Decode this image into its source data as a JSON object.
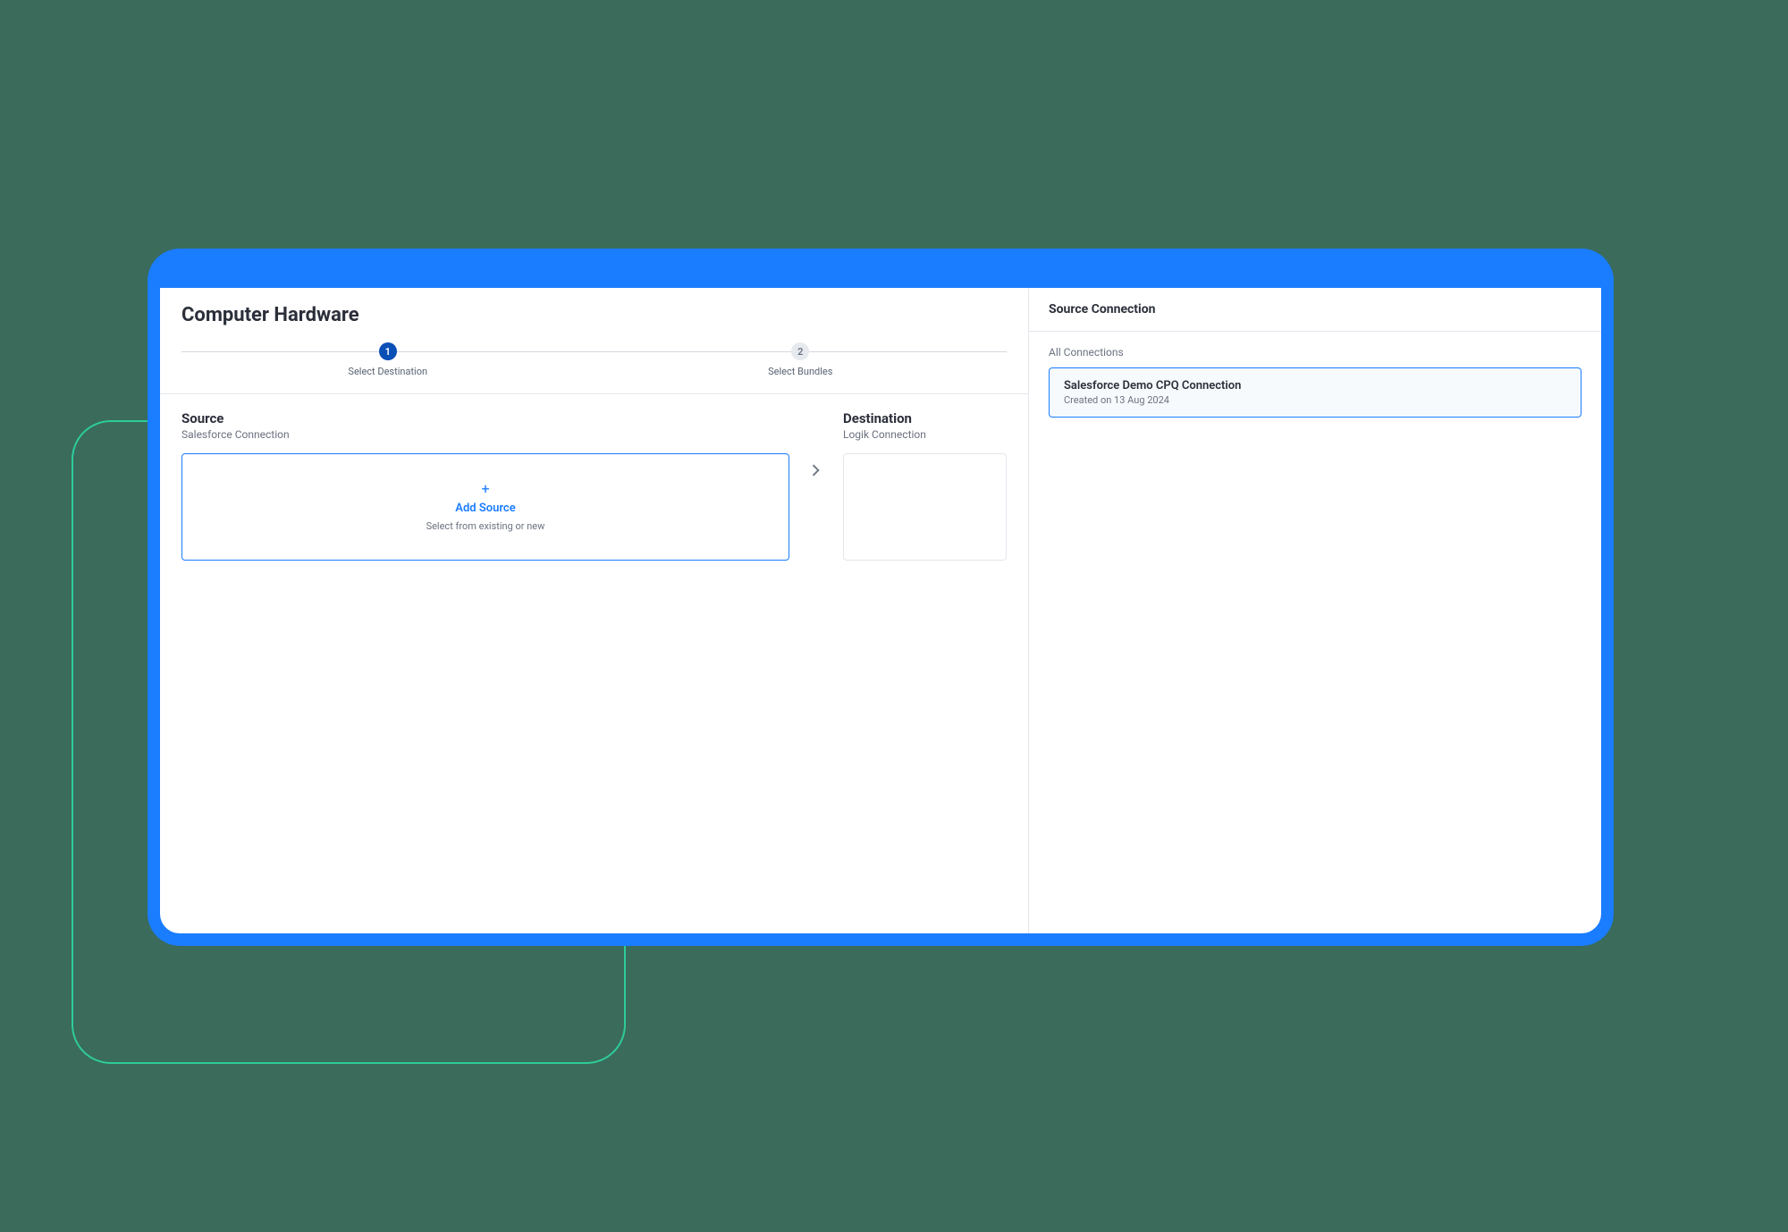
{
  "page": {
    "title": "Computer Hardware"
  },
  "stepper": {
    "steps": [
      {
        "num": "1",
        "label": "Select Destination",
        "active": true
      },
      {
        "num": "2",
        "label": "Select Bundles",
        "active": false
      }
    ]
  },
  "source": {
    "heading": "Source",
    "sub": "Salesforce Connection",
    "add_card": {
      "label": "Add Source",
      "sub": "Select from existing or new"
    }
  },
  "destination": {
    "heading": "Destination",
    "sub": "Logik Connection"
  },
  "side": {
    "header": "Source Connection",
    "section_label": "All Connections",
    "connections": [
      {
        "title": "Salesforce Demo CPQ Connection",
        "sub": "Created on 13 Aug 2024"
      }
    ]
  }
}
